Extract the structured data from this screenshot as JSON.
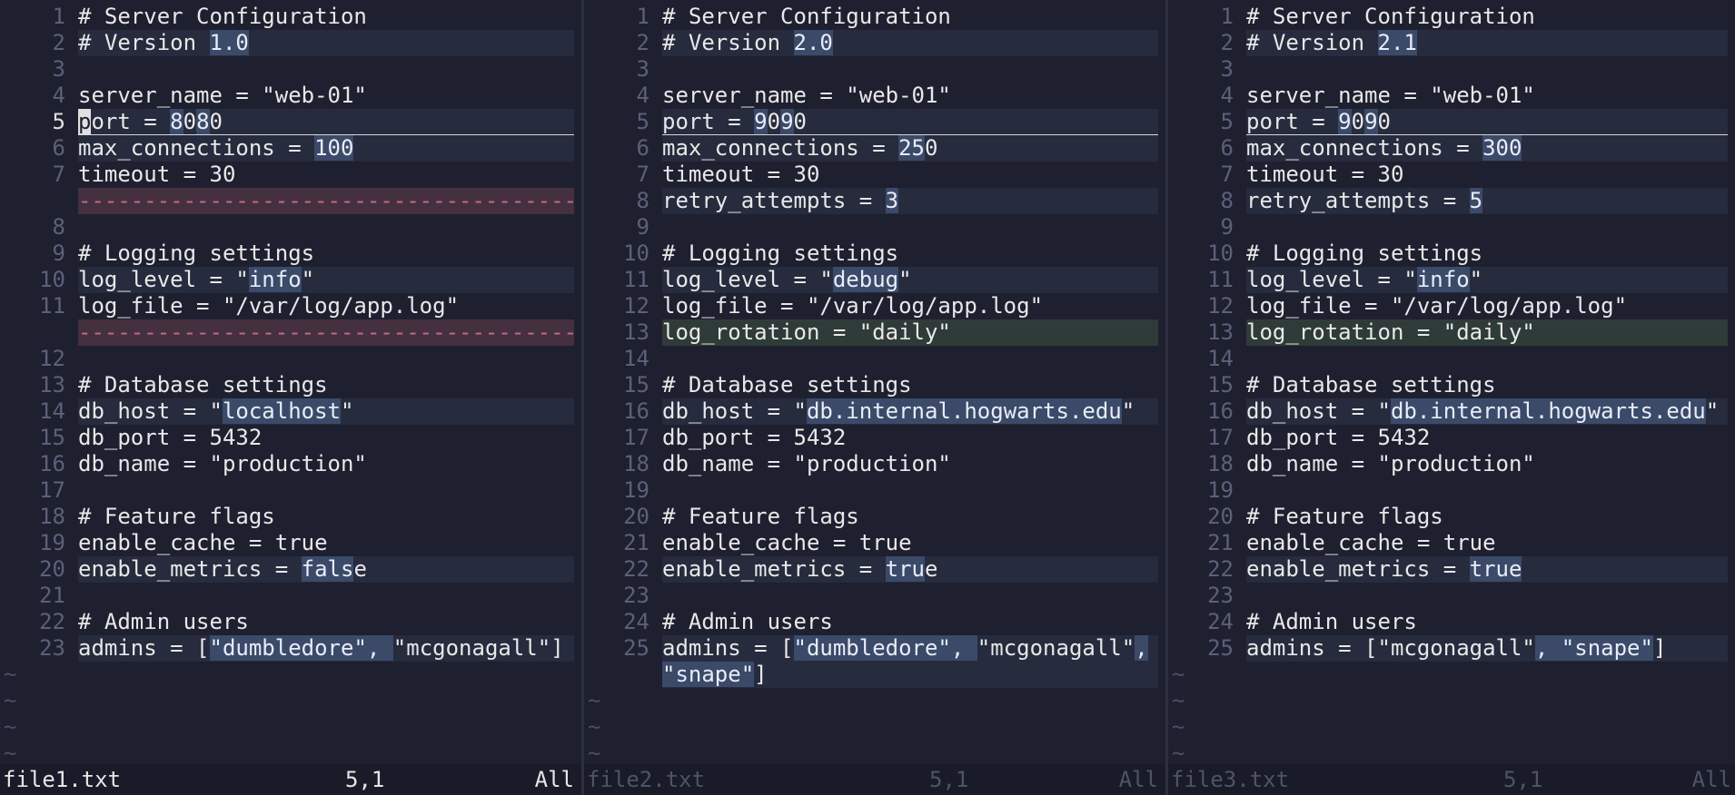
{
  "colors": {
    "background": "#1e2030",
    "changed_line": "#262b3d",
    "added_line": "#2f3b38",
    "deleted_line": "#45303f",
    "changed_text": "#3b4a69",
    "line_number": "#5c6079"
  },
  "panes": [
    {
      "lines": [
        {
          "num": "1",
          "type": "normal",
          "segments": [
            {
              "t": "# Server Configuration"
            }
          ]
        },
        {
          "num": "2",
          "type": "changed",
          "segments": [
            {
              "t": "# Version "
            },
            {
              "t": "1.0",
              "h": true
            }
          ]
        },
        {
          "num": "3",
          "type": "normal",
          "segments": []
        },
        {
          "num": "4",
          "type": "normal",
          "segments": [
            {
              "t": "server_name = \"web-01\""
            }
          ]
        },
        {
          "num": "5",
          "type": "changed",
          "cursorline": true,
          "current": true,
          "segments": [
            {
              "t": "p",
              "c": true
            },
            {
              "t": "ort = "
            },
            {
              "t": "8",
              "h": true
            },
            {
              "t": "0"
            },
            {
              "t": "8",
              "h": true
            },
            {
              "t": "0"
            }
          ]
        },
        {
          "num": "6",
          "type": "changed",
          "segments": [
            {
              "t": "max_connections = "
            },
            {
              "t": "100",
              "h": true
            }
          ]
        },
        {
          "num": "7",
          "type": "normal",
          "segments": [
            {
              "t": "timeout = 30"
            }
          ]
        },
        {
          "num": "",
          "type": "deleted",
          "segments": [
            {
              "t": "--------------------------------------------------"
            }
          ]
        },
        {
          "num": "8",
          "type": "normal",
          "segments": []
        },
        {
          "num": "9",
          "type": "normal",
          "segments": [
            {
              "t": "# Logging settings"
            }
          ]
        },
        {
          "num": "10",
          "type": "changed",
          "segments": [
            {
              "t": "log_level = \""
            },
            {
              "t": "info",
              "h": true
            },
            {
              "t": "\""
            }
          ]
        },
        {
          "num": "11",
          "type": "normal",
          "segments": [
            {
              "t": "log_file = \"/var/log/app.log\""
            }
          ]
        },
        {
          "num": "",
          "type": "deleted",
          "segments": [
            {
              "t": "--------------------------------------------------"
            }
          ]
        },
        {
          "num": "12",
          "type": "normal",
          "segments": []
        },
        {
          "num": "13",
          "type": "normal",
          "segments": [
            {
              "t": "# Database settings"
            }
          ]
        },
        {
          "num": "14",
          "type": "changed",
          "segments": [
            {
              "t": "db_host = \""
            },
            {
              "t": "localhost",
              "h": true
            },
            {
              "t": "\""
            }
          ]
        },
        {
          "num": "15",
          "type": "normal",
          "segments": [
            {
              "t": "db_port = 5432"
            }
          ]
        },
        {
          "num": "16",
          "type": "normal",
          "segments": [
            {
              "t": "db_name = \"production\""
            }
          ]
        },
        {
          "num": "17",
          "type": "normal",
          "segments": []
        },
        {
          "num": "18",
          "type": "normal",
          "segments": [
            {
              "t": "# Feature flags"
            }
          ]
        },
        {
          "num": "19",
          "type": "normal",
          "segments": [
            {
              "t": "enable_cache = true"
            }
          ]
        },
        {
          "num": "20",
          "type": "changed",
          "segments": [
            {
              "t": "enable_metrics = "
            },
            {
              "t": "fals",
              "h": true
            },
            {
              "t": "e"
            }
          ]
        },
        {
          "num": "21",
          "type": "normal",
          "segments": []
        },
        {
          "num": "22",
          "type": "normal",
          "segments": [
            {
              "t": "# Admin users"
            }
          ]
        },
        {
          "num": "23",
          "type": "changed",
          "segments": [
            {
              "t": "admins = ["
            },
            {
              "t": "\"dumbledore\", ",
              "h": true
            },
            {
              "t": "\"mcgonagall\"]"
            }
          ]
        }
      ],
      "tildes": 4,
      "status": {
        "filename": "file1.txt",
        "position": "5,1",
        "scroll": "All",
        "active": true
      }
    },
    {
      "lines": [
        {
          "num": "1",
          "type": "normal",
          "segments": [
            {
              "t": "# Server Configuration"
            }
          ]
        },
        {
          "num": "2",
          "type": "changed",
          "segments": [
            {
              "t": "# Version "
            },
            {
              "t": "2.0",
              "h": true
            }
          ]
        },
        {
          "num": "3",
          "type": "normal",
          "segments": []
        },
        {
          "num": "4",
          "type": "normal",
          "segments": [
            {
              "t": "server_name = \"web-01\""
            }
          ]
        },
        {
          "num": "5",
          "type": "changed",
          "cursorline": true,
          "segments": [
            {
              "t": "port = "
            },
            {
              "t": "9",
              "h": true
            },
            {
              "t": "0"
            },
            {
              "t": "9",
              "h": true
            },
            {
              "t": "0"
            }
          ]
        },
        {
          "num": "6",
          "type": "changed",
          "segments": [
            {
              "t": "max_connections = "
            },
            {
              "t": "25",
              "h": true
            },
            {
              "t": "0"
            }
          ]
        },
        {
          "num": "7",
          "type": "normal",
          "segments": [
            {
              "t": "timeout = 30"
            }
          ]
        },
        {
          "num": "8",
          "type": "changed",
          "segments": [
            {
              "t": "retry_attempts = "
            },
            {
              "t": "3",
              "h": true
            }
          ]
        },
        {
          "num": "9",
          "type": "normal",
          "segments": []
        },
        {
          "num": "10",
          "type": "normal",
          "segments": [
            {
              "t": "# Logging settings"
            }
          ]
        },
        {
          "num": "11",
          "type": "changed",
          "segments": [
            {
              "t": "log_level = \""
            },
            {
              "t": "debug",
              "h": true
            },
            {
              "t": "\""
            }
          ]
        },
        {
          "num": "12",
          "type": "normal",
          "segments": [
            {
              "t": "log_file = \"/var/log/app.log\""
            }
          ]
        },
        {
          "num": "13",
          "type": "added",
          "segments": [
            {
              "t": "log_rotation = \"daily\""
            }
          ]
        },
        {
          "num": "14",
          "type": "normal",
          "segments": []
        },
        {
          "num": "15",
          "type": "normal",
          "segments": [
            {
              "t": "# Database settings"
            }
          ]
        },
        {
          "num": "16",
          "type": "changed",
          "segments": [
            {
              "t": "db_host = \""
            },
            {
              "t": "db.internal.hogwarts.edu",
              "h": true
            },
            {
              "t": "\""
            }
          ]
        },
        {
          "num": "17",
          "type": "normal",
          "segments": [
            {
              "t": "db_port = 5432"
            }
          ]
        },
        {
          "num": "18",
          "type": "normal",
          "segments": [
            {
              "t": "db_name = \"production\""
            }
          ]
        },
        {
          "num": "19",
          "type": "normal",
          "segments": []
        },
        {
          "num": "20",
          "type": "normal",
          "segments": [
            {
              "t": "# Feature flags"
            }
          ]
        },
        {
          "num": "21",
          "type": "normal",
          "segments": [
            {
              "t": "enable_cache = true"
            }
          ]
        },
        {
          "num": "22",
          "type": "changed",
          "segments": [
            {
              "t": "enable_metrics = "
            },
            {
              "t": "tru",
              "h": true
            },
            {
              "t": "e"
            }
          ]
        },
        {
          "num": "23",
          "type": "normal",
          "segments": []
        },
        {
          "num": "24",
          "type": "normal",
          "segments": [
            {
              "t": "# Admin users"
            }
          ]
        },
        {
          "num": "25",
          "type": "changed",
          "segments": [
            {
              "t": "admins = ["
            },
            {
              "t": "\"dumbledore\", ",
              "h": true
            },
            {
              "t": "\"mcgonagall\""
            },
            {
              "t": ",",
              "h": true
            }
          ]
        },
        {
          "num": "",
          "type": "changed",
          "segments": [
            {
              "t": "\"snape\"",
              "h": true
            },
            {
              "t": "]"
            }
          ]
        }
      ],
      "tildes": 3,
      "status": {
        "filename": "file2.txt",
        "position": "5,1",
        "scroll": "All",
        "active": false
      }
    },
    {
      "lines": [
        {
          "num": "1",
          "type": "normal",
          "segments": [
            {
              "t": "# Server Configuration"
            }
          ]
        },
        {
          "num": "2",
          "type": "changed",
          "segments": [
            {
              "t": "# Version "
            },
            {
              "t": "2.1",
              "h": true
            }
          ]
        },
        {
          "num": "3",
          "type": "normal",
          "segments": []
        },
        {
          "num": "4",
          "type": "normal",
          "segments": [
            {
              "t": "server_name = \"web-01\""
            }
          ]
        },
        {
          "num": "5",
          "type": "changed",
          "cursorline": true,
          "segments": [
            {
              "t": "port = "
            },
            {
              "t": "9",
              "h": true
            },
            {
              "t": "0"
            },
            {
              "t": "9",
              "h": true
            },
            {
              "t": "0"
            }
          ]
        },
        {
          "num": "6",
          "type": "changed",
          "segments": [
            {
              "t": "max_connections = "
            },
            {
              "t": "300",
              "h": true
            }
          ]
        },
        {
          "num": "7",
          "type": "normal",
          "segments": [
            {
              "t": "timeout = 30"
            }
          ]
        },
        {
          "num": "8",
          "type": "changed",
          "segments": [
            {
              "t": "retry_attempts = "
            },
            {
              "t": "5",
              "h": true
            }
          ]
        },
        {
          "num": "9",
          "type": "normal",
          "segments": []
        },
        {
          "num": "10",
          "type": "normal",
          "segments": [
            {
              "t": "# Logging settings"
            }
          ]
        },
        {
          "num": "11",
          "type": "changed",
          "segments": [
            {
              "t": "log_level = \""
            },
            {
              "t": "info",
              "h": true
            },
            {
              "t": "\""
            }
          ]
        },
        {
          "num": "12",
          "type": "normal",
          "segments": [
            {
              "t": "log_file = \"/var/log/app.log\""
            }
          ]
        },
        {
          "num": "13",
          "type": "added",
          "segments": [
            {
              "t": "log_rotation = \"daily\""
            }
          ]
        },
        {
          "num": "14",
          "type": "normal",
          "segments": []
        },
        {
          "num": "15",
          "type": "normal",
          "segments": [
            {
              "t": "# Database settings"
            }
          ]
        },
        {
          "num": "16",
          "type": "changed",
          "segments": [
            {
              "t": "db_host = \""
            },
            {
              "t": "db.internal.hogwarts.edu",
              "h": true
            },
            {
              "t": "\""
            }
          ]
        },
        {
          "num": "17",
          "type": "normal",
          "segments": [
            {
              "t": "db_port = 5432"
            }
          ]
        },
        {
          "num": "18",
          "type": "normal",
          "segments": [
            {
              "t": "db_name = \"production\""
            }
          ]
        },
        {
          "num": "19",
          "type": "normal",
          "segments": []
        },
        {
          "num": "20",
          "type": "normal",
          "segments": [
            {
              "t": "# Feature flags"
            }
          ]
        },
        {
          "num": "21",
          "type": "normal",
          "segments": [
            {
              "t": "enable_cache = true"
            }
          ]
        },
        {
          "num": "22",
          "type": "changed",
          "segments": [
            {
              "t": "enable_metrics = "
            },
            {
              "t": "true",
              "h": true
            }
          ]
        },
        {
          "num": "23",
          "type": "normal",
          "segments": []
        },
        {
          "num": "24",
          "type": "normal",
          "segments": [
            {
              "t": "# Admin users"
            }
          ]
        },
        {
          "num": "25",
          "type": "changed",
          "segments": [
            {
              "t": "admins = [\"mcgonagall\""
            },
            {
              "t": ", \"snape\"",
              "h": true
            },
            {
              "t": "]"
            }
          ]
        }
      ],
      "tildes": 4,
      "status": {
        "filename": "file3.txt",
        "position": "5,1",
        "scroll": "All",
        "active": false
      }
    }
  ]
}
